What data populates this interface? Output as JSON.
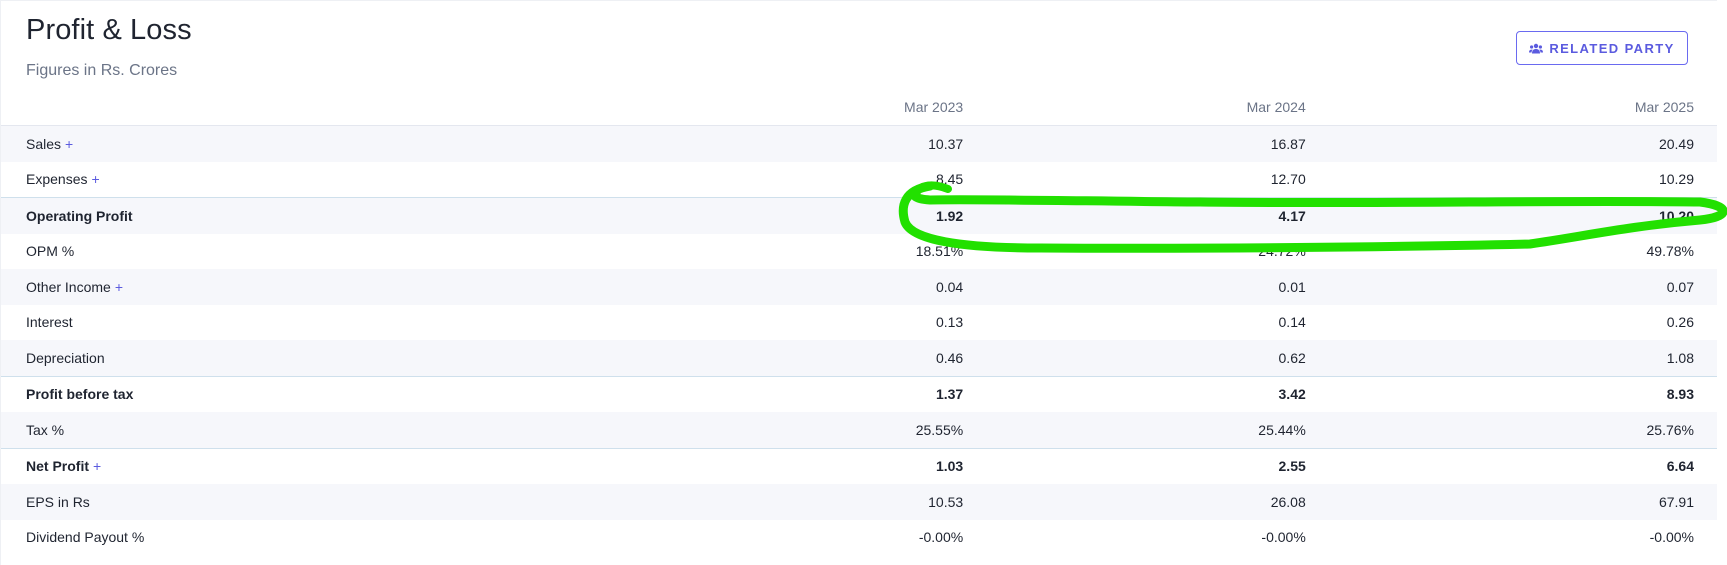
{
  "header": {
    "title": "Profit & Loss",
    "subtitle": "Figures in Rs. Crores",
    "related_party_label": "RELATED PARTY",
    "related_party_icon": "users-icon"
  },
  "table": {
    "columns": [
      "Mar 2023",
      "Mar 2024",
      "Mar 2025"
    ],
    "rows": [
      {
        "label": "Sales",
        "expandable": true,
        "values": [
          "10.37",
          "16.87",
          "20.49"
        ]
      },
      {
        "label": "Expenses",
        "expandable": true,
        "values": [
          "8.45",
          "12.70",
          "10.29"
        ]
      },
      {
        "label": "Operating Profit",
        "expandable": false,
        "values": [
          "1.92",
          "4.17",
          "10.20"
        ]
      },
      {
        "label": "OPM %",
        "expandable": false,
        "values": [
          "18.51%",
          "24.72%",
          "49.78%"
        ]
      },
      {
        "label": "Other Income",
        "expandable": true,
        "values": [
          "0.04",
          "0.01",
          "0.07"
        ]
      },
      {
        "label": "Interest",
        "expandable": false,
        "values": [
          "0.13",
          "0.14",
          "0.26"
        ]
      },
      {
        "label": "Depreciation",
        "expandable": false,
        "values": [
          "0.46",
          "0.62",
          "1.08"
        ]
      },
      {
        "label": "Profit before tax",
        "expandable": false,
        "values": [
          "1.37",
          "3.42",
          "8.93"
        ]
      },
      {
        "label": "Tax %",
        "expandable": false,
        "values": [
          "25.55%",
          "25.44%",
          "25.76%"
        ]
      },
      {
        "label": "Net Profit",
        "expandable": true,
        "values": [
          "1.03",
          "2.55",
          "6.64"
        ]
      },
      {
        "label": "EPS in Rs",
        "expandable": false,
        "values": [
          "10.53",
          "26.08",
          "67.91"
        ]
      },
      {
        "label": "Dividend Payout %",
        "expandable": false,
        "values": [
          "-0.00%",
          "-0.00%",
          "-0.00%"
        ]
      }
    ],
    "expand_symbol": "+"
  },
  "colors": {
    "accent": "#5b5bdf",
    "stripe": "#f6f7fb",
    "highlight_stroke": "#22e000"
  }
}
